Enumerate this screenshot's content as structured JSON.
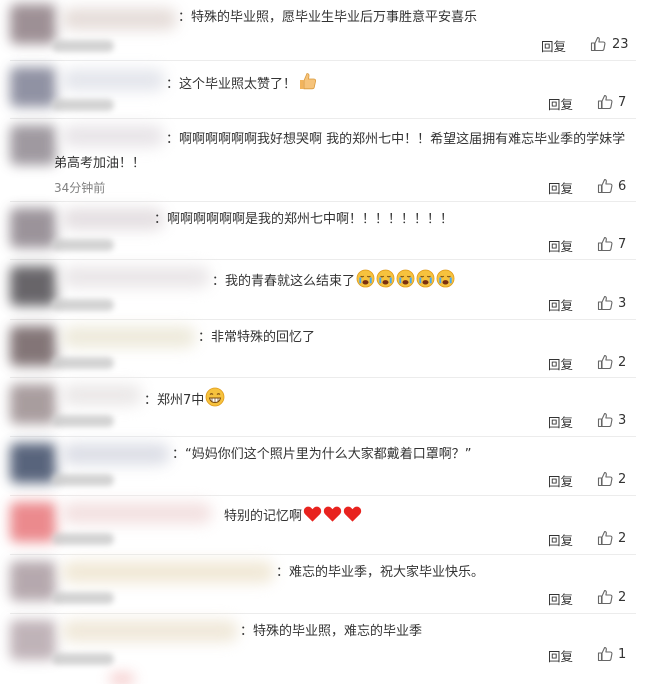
{
  "comments": [
    {
      "text": "：特殊的毕业照，愿毕业生毕业后万事胜意平安喜乐",
      "time": "",
      "reply": "回复",
      "likes": "23"
    },
    {
      "text": "：这个毕业照太赞了！",
      "time": "",
      "reply": "回复",
      "likes": "7",
      "emoji": "thumbs-up"
    },
    {
      "text": "：啊啊啊啊啊啊我好想哭啊 我的郑州七中！！希望这届拥有难忘毕业季的学妹学弟高考加油！！",
      "time": "34分钟前",
      "reply": "回复",
      "likes": "6"
    },
    {
      "text": "：啊啊啊啊啊啊是我的郑州七中啊！！！！！！！！",
      "time": "",
      "reply": "回复",
      "likes": "7"
    },
    {
      "text": "：我的青春就这么结束了",
      "time": "",
      "reply": "回复",
      "likes": "3",
      "emoji": "crying-x5"
    },
    {
      "text": "：非常特殊的回忆了",
      "time": "",
      "reply": "回复",
      "likes": "2"
    },
    {
      "text": "：郑州7中",
      "time": "",
      "reply": "回复",
      "likes": "3",
      "emoji": "grin"
    },
    {
      "text": "：“妈妈你们这个照片里为什么大家都戴着口罩啊？”",
      "time": "",
      "reply": "回复",
      "likes": "2"
    },
    {
      "text": "特别的记忆啊",
      "time": "",
      "reply": "回复",
      "likes": "2",
      "emoji": "hearts-x3"
    },
    {
      "text": "：难忘的毕业季，祝大家毕业快乐。",
      "time": "",
      "reply": "回复",
      "likes": "2"
    },
    {
      "text": "：特殊的毕业照，难忘的毕业季",
      "time": "",
      "reply": "回复",
      "likes": "1"
    }
  ],
  "colors": {
    "text": "#333333",
    "muted": "#808080",
    "separator": "#ececec",
    "heart": "#e8231f",
    "emoji_face": "#f6c23e"
  },
  "icons": {
    "like": "thumbs-up-outline-icon"
  }
}
